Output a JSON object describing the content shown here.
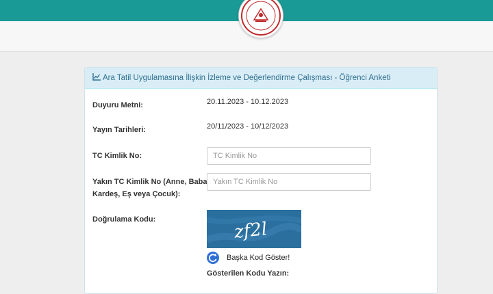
{
  "header": {
    "logo_icon": "ministry-seal-icon",
    "colors": {
      "topbar": "#1a9a96",
      "panel_header": "#d9edf7",
      "panel_text": "#31708f"
    }
  },
  "panel": {
    "icon": "line-chart-icon",
    "title": "Ara Tatil Uygulamasına İlişkin İzleme ve Değerlendirme Çalışması - Öğrenci Anketi"
  },
  "form": {
    "announcement": {
      "label": "Duyuru Metni:",
      "value": "20.11.2023 - 10.12.2023"
    },
    "publish_dates": {
      "label": "Yayın Tarihleri:",
      "value": "20/11/2023 - 10/12/2023"
    },
    "tc_id": {
      "label": "TC Kimlik No:",
      "placeholder": "TC Kimlik No",
      "value": ""
    },
    "relative_id": {
      "label_line1": "Yakın TC Kimlik No (Anne, Baba,",
      "label_line2": "Kardeş, Eş veya Çocuk):",
      "placeholder": "Yakın TC Kimlik No",
      "value": ""
    },
    "captcha": {
      "label": "Doğrulama Kodu:",
      "code": "zf2l",
      "refresh_icon": "refresh-icon",
      "refresh_label": "Başka Kod Göster!",
      "prompt": "Gösterilen Kodu Yazın:"
    }
  }
}
